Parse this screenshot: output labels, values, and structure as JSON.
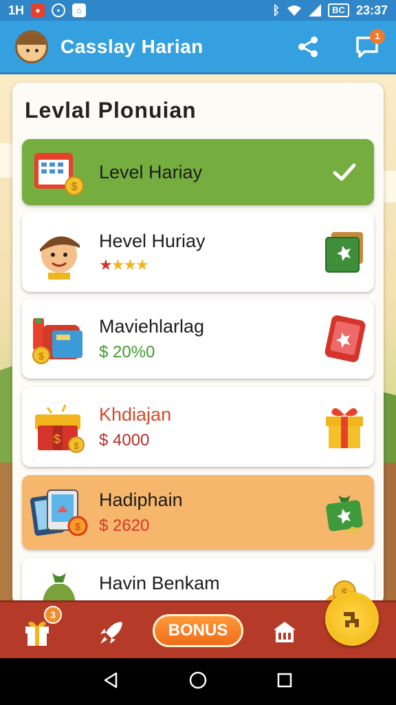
{
  "status_bar": {
    "left_text": "1H",
    "time": "23:37",
    "battery": "BC",
    "icons": [
      "notification-icon",
      "target-icon",
      "app-icon",
      "bluetooth-icon",
      "wifi-icon",
      "signal-icon"
    ]
  },
  "app_bar": {
    "title": "Casslay Harian",
    "notification_count": "1"
  },
  "panel": {
    "title": "Levlal Plonuian",
    "items": [
      {
        "name": "Level Hariay",
        "state": "selected",
        "icon": "calendar-coin-icon",
        "right_icon": "check-icon"
      },
      {
        "name": "Hevel Huriay",
        "rating": {
          "red_stars": 1,
          "yellow_stars": 3
        },
        "icon": "boy-avatar-icon",
        "right_icon": "green-card-icon"
      },
      {
        "name": "Maviehlarlag",
        "sub": "$ 20%0",
        "icon": "wallet-coin-icon",
        "right_icon": "red-tablet-icon"
      },
      {
        "name": "Khdiajan",
        "sub": "$ 4000",
        "icon": "red-chest-icon",
        "right_icon": "gift-box-icon"
      },
      {
        "name": "Hadiphain",
        "sub": "$ 2620",
        "state": "highlighted",
        "icon": "tablet-coin-icon",
        "right_icon": "money-bag-icon"
      },
      {
        "name": "Havin Benkam",
        "icon": "green-bag-icon",
        "right_icon": "coin-pile-icon"
      }
    ]
  },
  "bottom_nav": {
    "gift_badge": "3",
    "bonus_label": "BONUS",
    "items": [
      "gift-icon",
      "rocket-icon",
      "bonus-button",
      "house-icon",
      "gold-fab-icon"
    ]
  },
  "colors": {
    "app_bar": "#35a0e0",
    "selected_card": "#76ad3f",
    "orange_card": "#f6b66b",
    "bottom_nav": "#b53a27",
    "bonus": "#f06c1a",
    "fab": "#f2b512"
  }
}
